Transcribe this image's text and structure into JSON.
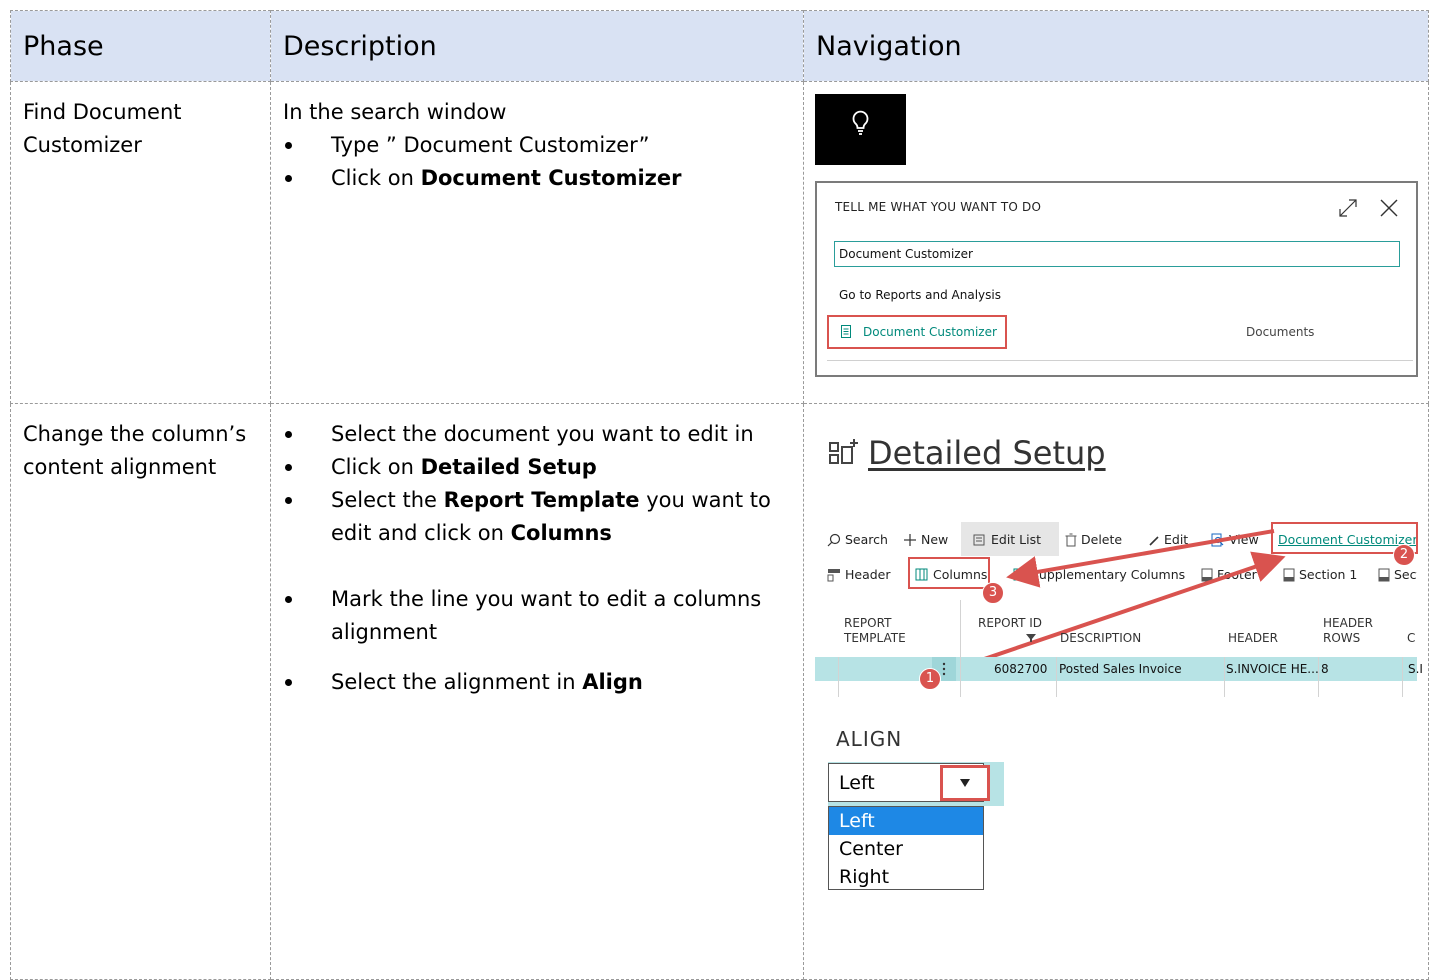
{
  "headers": {
    "phase": "Phase",
    "description": "Description",
    "navigation": "Navigation"
  },
  "rows": [
    {
      "phase": "Find Document Customizer",
      "description_intro": "In the search window",
      "bullets": [
        {
          "text": "Type ” Document Customizer”",
          "bold": ""
        },
        {
          "prefix": "Click on ",
          "bold": "Document Customizer"
        }
      ]
    },
    {
      "phase": "Change the column’s content alignment",
      "bullets": [
        {
          "text": "Select the document you want to edit in"
        },
        {
          "prefix": "Click on ",
          "bold": "Detailed Setup"
        },
        {
          "prefix": "Select the ",
          "bold": "Report Template",
          "mid": " you want to edit and click on ",
          "bold2": "Columns"
        },
        {
          "text": "Mark the line you want to edit a columns alignment"
        },
        {
          "prefix": "Select the alignment in ",
          "bold": "Align"
        }
      ]
    }
  ],
  "tellme": {
    "title": "TELL ME WHAT YOU WANT TO DO",
    "input_value": "Document Customizer",
    "goto": "Go to Reports and Analysis",
    "result_label": "Document Customizer",
    "result_category": "Documents"
  },
  "detailed_setup": {
    "title": "Detailed Setup",
    "toolbar_row1": [
      "Search",
      "New",
      "Edit List",
      "Delete",
      "Edit",
      "View",
      "Document Customizer"
    ],
    "toolbar_row2": [
      "Header",
      "Columns",
      "Supplementary Columns",
      "Footer",
      "Section 1",
      "Sect"
    ],
    "columns": {
      "report_template": [
        "REPORT",
        "TEMPLATE"
      ],
      "report_id": "REPORT ID",
      "description": "DESCRIPTION",
      "header": "HEADER",
      "header_rows": [
        "HEADER",
        "ROWS"
      ],
      "c": "C"
    },
    "row": {
      "report_id": "6082700",
      "description": "Posted Sales Invoice",
      "header": "S.INVOICE HE...",
      "header_rows": "8",
      "c": "S.I"
    },
    "markers": [
      "1",
      "2",
      "3"
    ],
    "align_label": "ALIGN",
    "align_value": "Left",
    "align_options": [
      "Left",
      "Center",
      "Right"
    ]
  },
  "colors": {
    "header_bg": "#d9e2f3",
    "highlight": "#d9534f",
    "accent": "#00897b",
    "selected_row": "#b7e3e5"
  }
}
